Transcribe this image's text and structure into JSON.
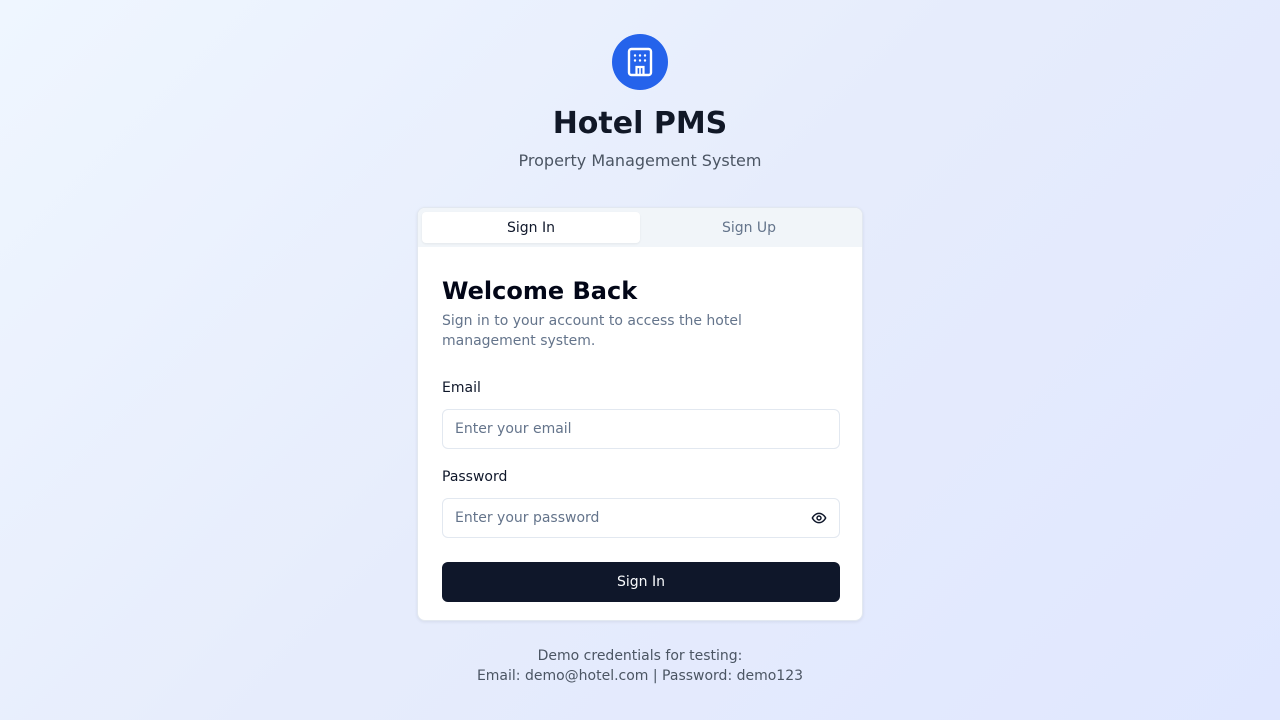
{
  "app": {
    "title": "Hotel PMS",
    "subtitle": "Property Management System",
    "logo_icon": "building-icon",
    "accent_color": "#2563eb"
  },
  "tabs": [
    {
      "label": "Sign In",
      "active": true
    },
    {
      "label": "Sign Up",
      "active": false
    }
  ],
  "form": {
    "heading": "Welcome Back",
    "description": "Sign in to your account to access the hotel management system.",
    "email": {
      "label": "Email",
      "placeholder": "Enter your email",
      "value": ""
    },
    "password": {
      "label": "Password",
      "placeholder": "Enter your password",
      "value": "",
      "toggle_icon": "eye-icon"
    },
    "submit_label": "Sign In",
    "button_color": "#0f172a"
  },
  "demo": {
    "line1": "Demo credentials for testing:",
    "line2": "Email: demo@hotel.com | Password: demo123"
  }
}
